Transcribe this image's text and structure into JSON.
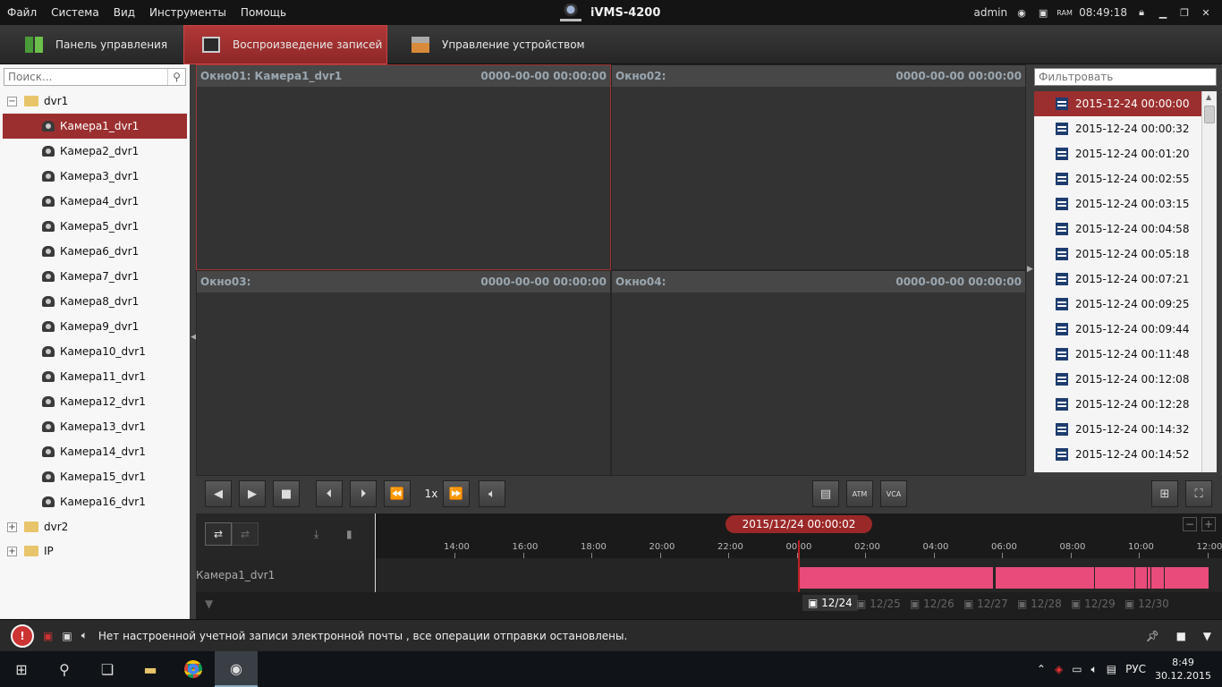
{
  "menu": [
    "Файл",
    "Система",
    "Вид",
    "Инструменты",
    "Помощь"
  ],
  "app_title": "iVMS-4200",
  "titlebar": {
    "user": "admin",
    "time": "08:49:18"
  },
  "tabs": [
    {
      "label": "Панель управления",
      "active": false
    },
    {
      "label": "Воспроизведение записей",
      "active": true
    },
    {
      "label": "Управление устройством",
      "active": false
    }
  ],
  "search": {
    "placeholder": "Поиск..."
  },
  "tree": {
    "dvr1": "dvr1",
    "cameras": [
      "Камера1_dvr1",
      "Камера2_dvr1",
      "Камера3_dvr1",
      "Камера4_dvr1",
      "Камера5_dvr1",
      "Камера6_dvr1",
      "Камера7_dvr1",
      "Камера8_dvr1",
      "Камера9_dvr1",
      "Камера10_dvr1",
      "Камера11_dvr1",
      "Камера12_dvr1",
      "Камера13_dvr1",
      "Камера14_dvr1",
      "Камера15_dvr1",
      "Камера16_dvr1"
    ],
    "dvr2": "dvr2",
    "ip": "IP"
  },
  "windows": [
    {
      "title": "Окно01:  Камера1_dvr1",
      "time": "0000-00-00 00:00:00"
    },
    {
      "title": "Окно02:",
      "time": "0000-00-00 00:00:00"
    },
    {
      "title": "Окно03:",
      "time": "0000-00-00 00:00:00"
    },
    {
      "title": "Окно04:",
      "time": "0000-00-00 00:00:00"
    }
  ],
  "filter": {
    "placeholder": "Фильтровать"
  },
  "records": [
    "2015-12-24 00:00:00",
    "2015-12-24 00:00:32",
    "2015-12-24 00:01:20",
    "2015-12-24 00:02:55",
    "2015-12-24 00:03:15",
    "2015-12-24 00:04:58",
    "2015-12-24 00:05:18",
    "2015-12-24 00:07:21",
    "2015-12-24 00:09:25",
    "2015-12-24 00:09:44",
    "2015-12-24 00:11:48",
    "2015-12-24 00:12:08",
    "2015-12-24 00:12:28",
    "2015-12-24 00:14:32",
    "2015-12-24 00:14:52"
  ],
  "controls": {
    "speed": "1x"
  },
  "timeline": {
    "date": "2015/12/24 00:00:02",
    "ticks": [
      "14:00",
      "16:00",
      "18:00",
      "20:00",
      "22:00",
      "00:00",
      "02:00",
      "04:00",
      "06:00",
      "08:00",
      "10:00",
      "12:00"
    ],
    "camera": "Камера1_dvr1",
    "days": [
      "12/24",
      "12/25",
      "12/26",
      "12/27",
      "12/28",
      "12/29",
      "12/30"
    ]
  },
  "status": {
    "message": "Нет настроенной учетной записи электронной почты , все операции отправки остановлены."
  },
  "taskbar": {
    "lang": "РУС",
    "time": "8:49",
    "date": "30.12.2015"
  },
  "colors": {
    "accent": "#9b2f2f",
    "recording": "#e94b7a"
  }
}
